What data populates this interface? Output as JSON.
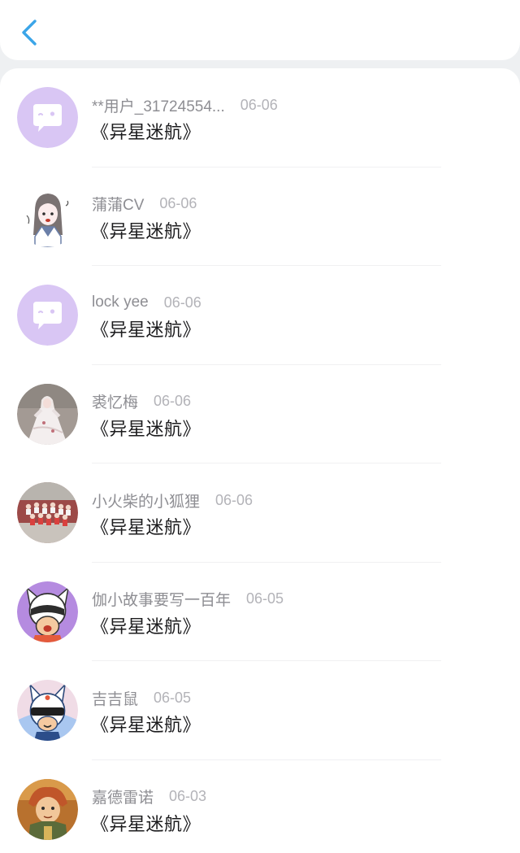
{
  "header": {
    "back_icon": "chevron-left-icon",
    "accent_color": "#3ba5e8"
  },
  "comments": [
    {
      "user": "**用户_31724554...",
      "date": "06-06",
      "text": "《异星迷航》",
      "avatar": "default-chat-avatar"
    },
    {
      "user": "蒲蒲CV",
      "date": "06-06",
      "text": "《异星迷航》",
      "avatar": "anime-girl-sketch-avatar"
    },
    {
      "user": "lock yee",
      "date": "06-06",
      "text": "《异星迷航》",
      "avatar": "default-chat-avatar"
    },
    {
      "user": "裘忆梅",
      "date": "06-06",
      "text": "《异星迷航》",
      "avatar": "white-gown-photo-avatar"
    },
    {
      "user": "小火柴的小狐狸",
      "date": "06-06",
      "text": "《异星迷航》",
      "avatar": "group-photo-avatar"
    },
    {
      "user": "伽小故事要写一百年",
      "date": "06-05",
      "text": "《异星迷航》",
      "avatar": "helmet-cartoon-avatar"
    },
    {
      "user": "吉吉鼠",
      "date": "06-05",
      "text": "《异星迷航》",
      "avatar": "masked-mouse-cartoon-avatar"
    },
    {
      "user": "嘉德雷诺",
      "date": "06-03",
      "text": "《异星迷航》",
      "avatar": "illustrated-character-avatar"
    }
  ]
}
